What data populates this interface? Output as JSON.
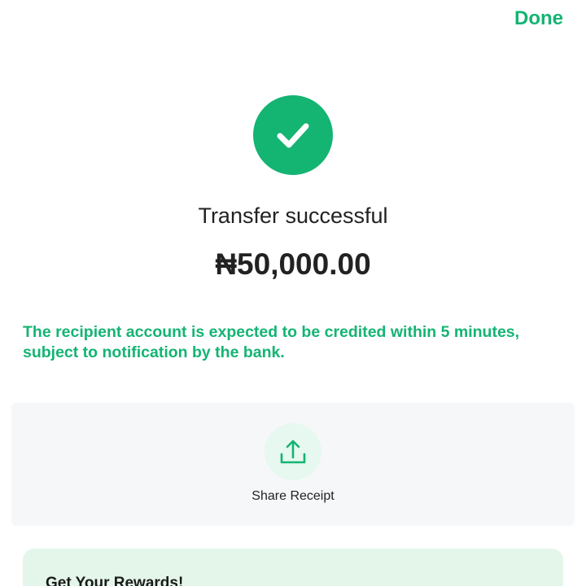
{
  "header": {
    "done_label": "Done"
  },
  "status": {
    "title": "Transfer successful",
    "amount": "₦50,000.00",
    "notice": "The recipient account is expected to be credited within 5 minutes, subject to notification by the bank."
  },
  "share": {
    "label": "Share Receipt"
  },
  "rewards": {
    "title": "Get Your Rewards!"
  },
  "colors": {
    "accent": "#14b473",
    "share_bg": "#f6f7f9",
    "rewards_bg": "#e4f6ea"
  },
  "icons": {
    "success": "check-icon",
    "share": "upload-share-icon"
  }
}
